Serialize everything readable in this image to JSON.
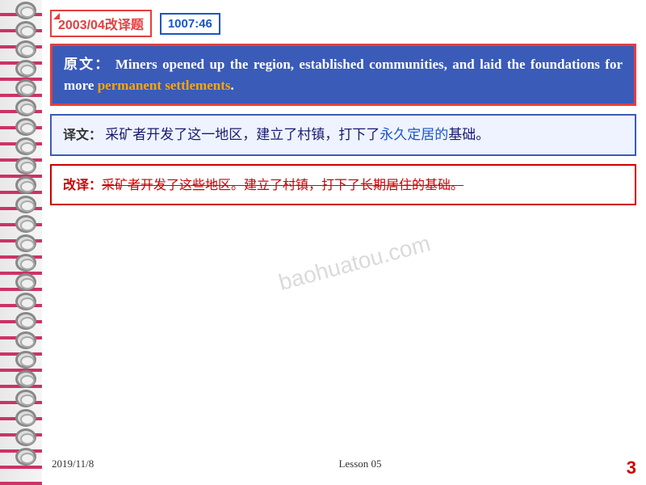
{
  "header": {
    "year_label": "2003/04改译题",
    "time_label": "1007:46"
  },
  "original": {
    "prefix": "原文：",
    "english": "Miners opened up the region, established communities, and laid the foundations for more",
    "highlight": "permanent settlements",
    "suffix": "."
  },
  "translation": {
    "prefix": "译文：",
    "text": "采矿者开发了这一地区，建立了村镇，打下了",
    "highlight": "永久定居的",
    "suffix": "基础。"
  },
  "revised": {
    "prefix": "改译：",
    "text": "采矿者开发了这些地区。建立了村镇，打下了长期居住的基础。"
  },
  "footer": {
    "date": "2019/11/8",
    "lesson": "Lesson 05",
    "page": "3"
  },
  "watermark": "baohuatou.com"
}
